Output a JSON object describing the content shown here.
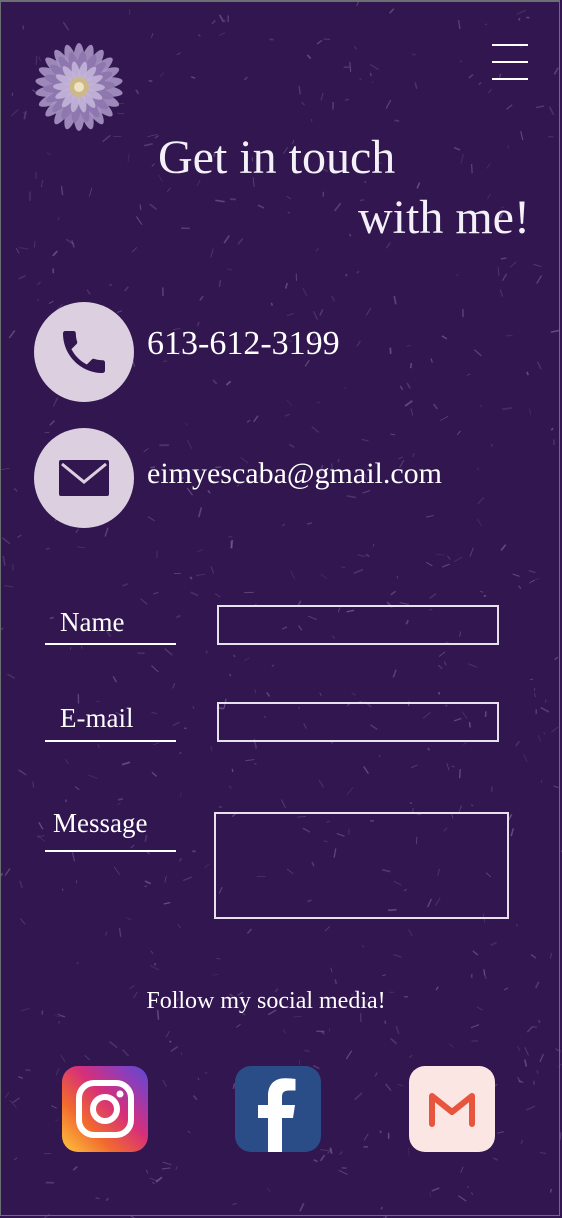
{
  "header": {
    "logo": "purple-aster-flower-logo",
    "menu_icon": "hamburger-menu-icon"
  },
  "hero": {
    "title_line1": "Get in touch",
    "title_line2": "with me!"
  },
  "contact": {
    "phone": "613-612-3199",
    "phone_icon": "phone-icon",
    "email": "eimyescaba@gmail.com",
    "email_icon": "envelope-icon"
  },
  "form": {
    "name_label": "Name",
    "name_value": "",
    "email_label": "E-mail",
    "email_value": "",
    "message_label": "Message",
    "message_value": ""
  },
  "social": {
    "heading": "Follow my social media!",
    "links": [
      {
        "name": "Instagram",
        "icon": "instagram-icon"
      },
      {
        "name": "Facebook",
        "icon": "facebook-icon"
      },
      {
        "name": "Gmail",
        "icon": "gmail-icon"
      }
    ]
  },
  "colors": {
    "background": "#32164f",
    "icon_circle": "#dcd0e0",
    "icon_glyph": "#32164f",
    "facebook_blue": "#2a4d88",
    "gmail_bg": "#fbe6e3",
    "gmail_red": "#e8553e"
  }
}
